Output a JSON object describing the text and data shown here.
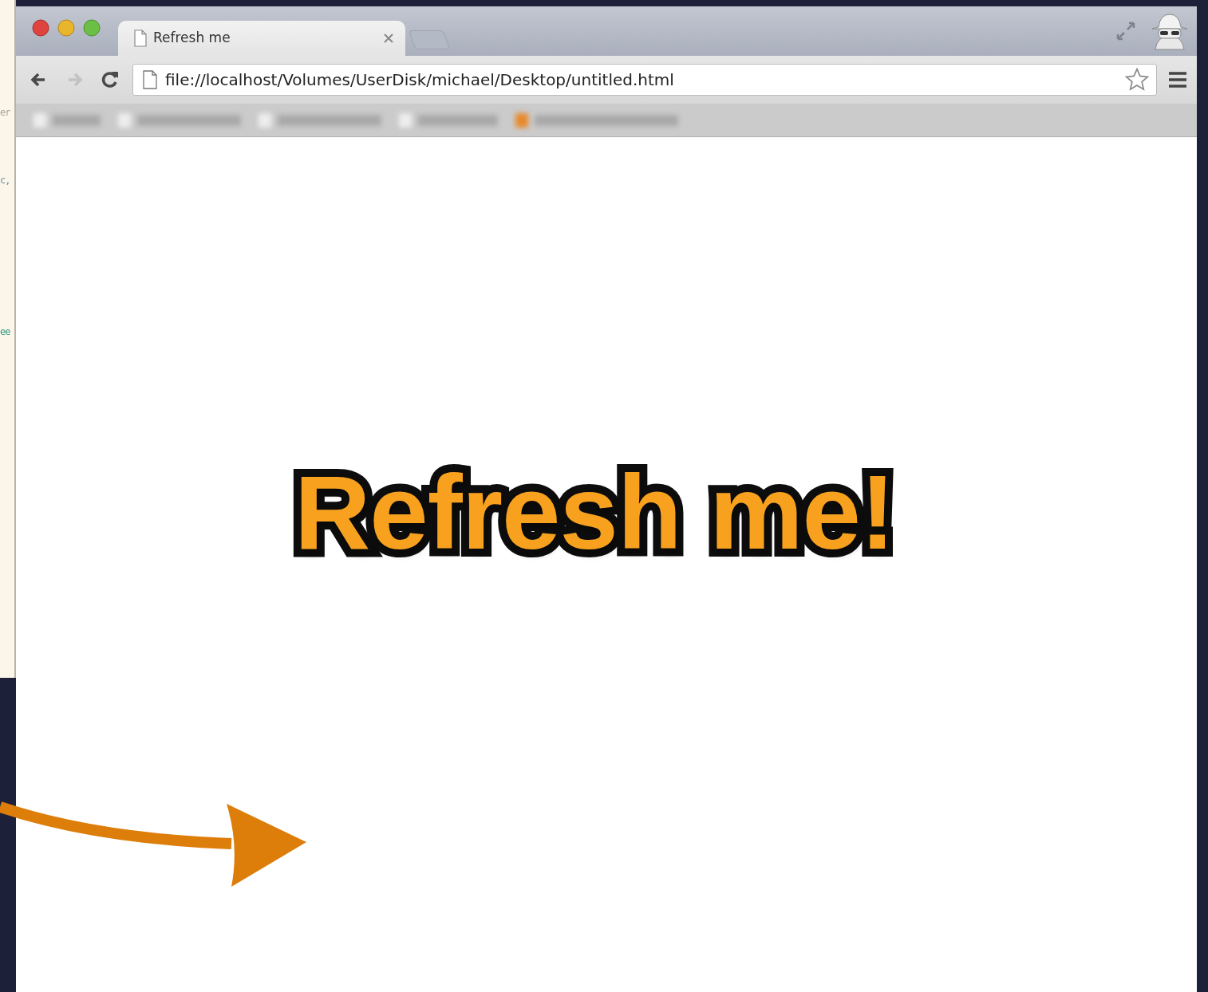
{
  "background_editor": {
    "fragments": [
      {
        "text": "er",
        "color": "#a8a49a"
      },
      {
        "text": "c,",
        "color": "#6f8fa0"
      },
      {
        "text": "ee",
        "color": "#3f9a86"
      }
    ]
  },
  "window": {
    "tabs": [
      {
        "title": "Refresh me",
        "selected": true
      }
    ],
    "nav_buttons": [
      {
        "kind": "back",
        "disabled": false
      },
      {
        "kind": "forward",
        "disabled": true
      },
      {
        "kind": "reload",
        "disabled": false
      }
    ],
    "address": "file://localhost/Volumes/UserDisk/michael/Desktop/untitled.html"
  },
  "page": {
    "heading": "Refresh me!"
  }
}
